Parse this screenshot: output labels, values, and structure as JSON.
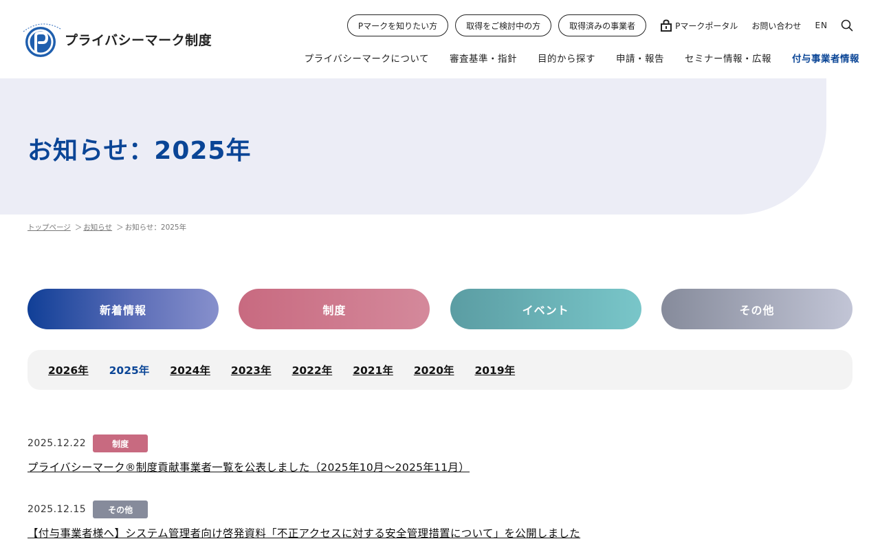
{
  "header": {
    "logo_text": "プライバシーマーク制度",
    "util_buttons": [
      "Pマークを知りたい方",
      "取得をご検討中の方",
      "取得済みの事業者"
    ],
    "portal_label": "Pマークポータル",
    "contact_label": "お問い合わせ",
    "lang_label": "EN",
    "nav": [
      {
        "label": "プライバシーマークについて"
      },
      {
        "label": "審査基準・指針"
      },
      {
        "label": "目的から探す"
      },
      {
        "label": "申請・報告"
      },
      {
        "label": "セミナー情報・広報"
      },
      {
        "label": "付与事業者情報",
        "active": true
      }
    ]
  },
  "hero": {
    "title": "お知らせ：2025年"
  },
  "breadcrumb": {
    "items": [
      "トップページ",
      "お知らせ"
    ],
    "current": "お知らせ：2025年",
    "separator": "＞"
  },
  "categories": [
    {
      "label": "新着情報",
      "key": "news"
    },
    {
      "label": "制度",
      "key": "system"
    },
    {
      "label": "イベント",
      "key": "event"
    },
    {
      "label": "その他",
      "key": "other"
    }
  ],
  "years": [
    {
      "label": "2026年"
    },
    {
      "label": "2025年",
      "active": true
    },
    {
      "label": "2024年"
    },
    {
      "label": "2023年"
    },
    {
      "label": "2022年"
    },
    {
      "label": "2021年"
    },
    {
      "label": "2020年"
    },
    {
      "label": "2019年"
    }
  ],
  "news": [
    {
      "date": "2025.12.22",
      "tag": "制度",
      "tag_color": "#c86a80",
      "title": "プライバシーマーク®制度貢献事業者一覧を公表しました（2025年10月～2025年11月）"
    },
    {
      "date": "2025.12.15",
      "tag": "その他",
      "tag_color": "#868b9b",
      "title": "【付与事業者様へ】システム管理者向け啓発資料「不正アクセスに対する安全管理措置について」を公開しました"
    }
  ],
  "colors": {
    "brand_blue": "#0a4596",
    "hero_bg": "#ecedf6"
  }
}
